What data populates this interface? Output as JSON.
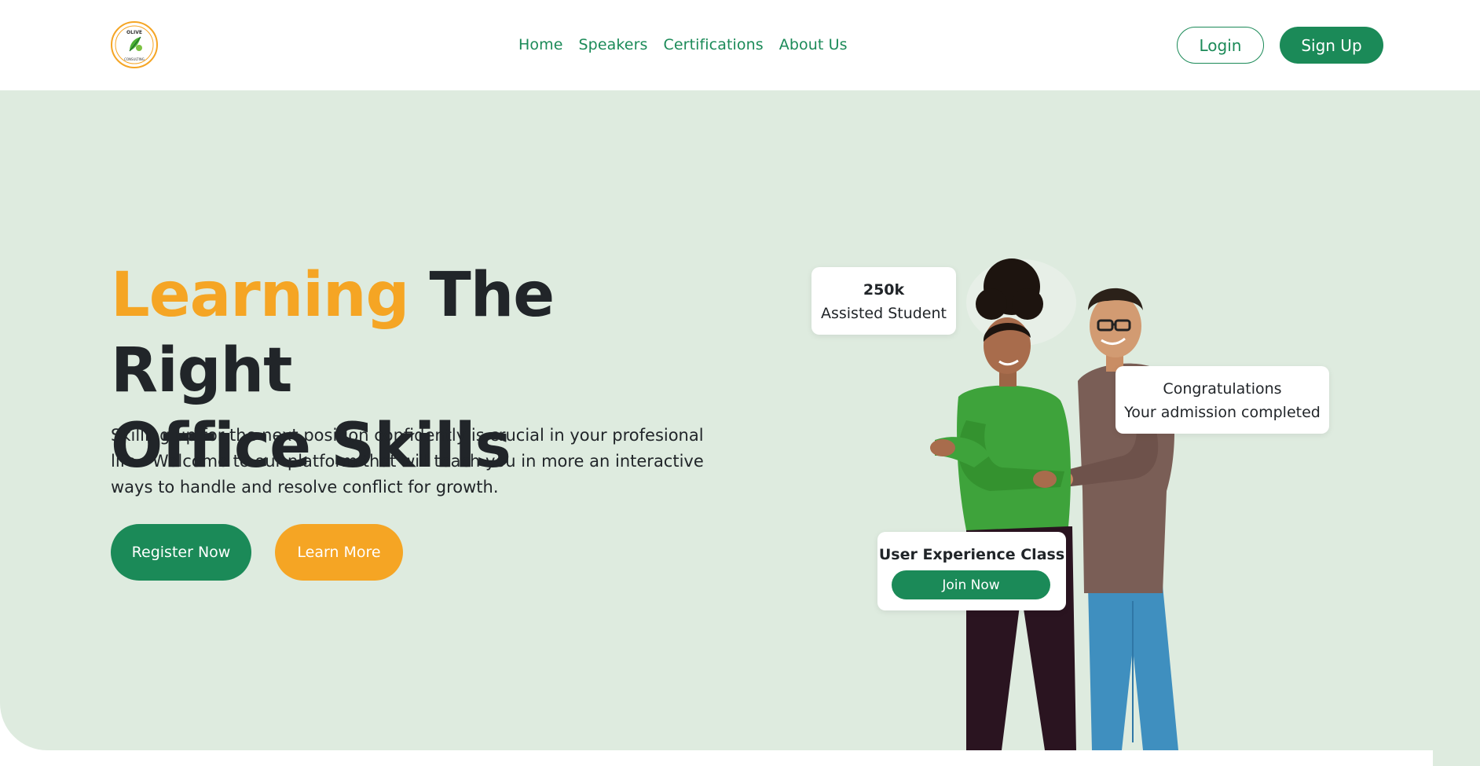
{
  "header": {
    "logo": {
      "name": "olive-consulting-logo",
      "text_top": "OLIVE",
      "text_bottom": "CONSULTING"
    },
    "nav": [
      {
        "label": "Home"
      },
      {
        "label": "Speakers"
      },
      {
        "label": "Certifications"
      },
      {
        "label": "About Us"
      }
    ],
    "login_label": "Login",
    "signup_label": "Sign Up"
  },
  "hero": {
    "title_accent": "Learning",
    "title_rest_line1": "The Right",
    "title_line2": "Office Skills",
    "description": "Skilling up for the next position confidently is crucial in your profesional life - Welcome to our platform that will teach you in more an interactive ways to handle and resolve conflict for growth.",
    "register_label": "Register Now",
    "learn_more_label": "Learn More"
  },
  "cards": {
    "students": {
      "value": "250k",
      "label": "Assisted Student"
    },
    "congrats": {
      "line1": "Congratulations",
      "line2": "Your admission completed"
    },
    "class": {
      "title": "User Experience Class",
      "button_label": "Join Now"
    }
  },
  "colors": {
    "brand_green": "#1b8a58",
    "accent_orange": "#f5a524",
    "hero_bg": "#deebdf",
    "text_dark": "#212529"
  }
}
